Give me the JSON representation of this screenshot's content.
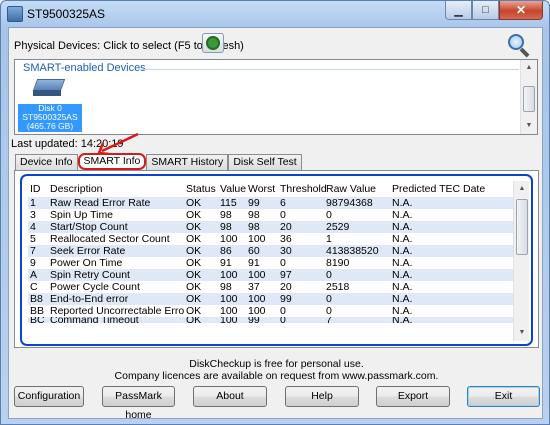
{
  "window": {
    "title": "ST9500325AS",
    "minimize": "▁",
    "maximize": "□",
    "close": "✕"
  },
  "header": {
    "physical_devices_label": "Physical Devices: Click to select (F5 to refresh)"
  },
  "devices": {
    "group_label": "SMART-enabled Devices",
    "items": [
      {
        "line1": "Disk 0",
        "line2": "ST9500325AS",
        "line3": "(465.76 GB)"
      }
    ]
  },
  "last_updated": "Last updated: 14:20:19",
  "tabs": [
    {
      "label": "Device Info",
      "active": false
    },
    {
      "label": "SMART Info",
      "active": true
    },
    {
      "label": "SMART History",
      "active": false
    },
    {
      "label": "Disk Self Test",
      "active": false
    }
  ],
  "smart_table": {
    "columns": [
      "ID",
      "Description",
      "Status",
      "Value",
      "Worst",
      "Threshold",
      "Raw Value",
      "Predicted TEC Date"
    ],
    "rows": [
      [
        "1",
        "Raw Read Error Rate",
        "OK",
        "115",
        "99",
        "6",
        "98794368",
        "N.A."
      ],
      [
        "3",
        "Spin Up Time",
        "OK",
        "98",
        "98",
        "0",
        "0",
        "N.A."
      ],
      [
        "4",
        "Start/Stop Count",
        "OK",
        "98",
        "98",
        "20",
        "2529",
        "N.A."
      ],
      [
        "5",
        "Reallocated Sector Count",
        "OK",
        "100",
        "100",
        "36",
        "1",
        "N.A."
      ],
      [
        "7",
        "Seek Error Rate",
        "OK",
        "86",
        "60",
        "30",
        "413838520",
        "N.A."
      ],
      [
        "9",
        "Power On Time",
        "OK",
        "91",
        "91",
        "0",
        "8190",
        "N.A."
      ],
      [
        "A",
        "Spin Retry Count",
        "OK",
        "100",
        "100",
        "97",
        "0",
        "N.A."
      ],
      [
        "C",
        "Power Cycle Count",
        "OK",
        "98",
        "37",
        "20",
        "2518",
        "N.A."
      ],
      [
        "B8",
        "End-to-End error",
        "OK",
        "100",
        "100",
        "99",
        "0",
        "N.A."
      ],
      [
        "BB",
        "Reported Uncorrectable Errors",
        "OK",
        "100",
        "100",
        "0",
        "0",
        "N.A."
      ],
      [
        "BC",
        "Command Timeout",
        "OK",
        "100",
        "99",
        "0",
        "7",
        "N.A."
      ]
    ]
  },
  "footer": {
    "line1": "DiskCheckup is free for personal use.",
    "line2": "Company licences are available on request from www.passmark.com."
  },
  "buttons": {
    "configuration": "Configuration",
    "passmark_home": "PassMark home",
    "about": "About",
    "help": "Help",
    "export": "Export",
    "exit": "Exit"
  },
  "colors": {
    "annotation_red": "#d61b1b",
    "highlight_blue": "#0a44cc",
    "selection_blue": "#3399ff",
    "row_alt": "#dfe8f6"
  }
}
